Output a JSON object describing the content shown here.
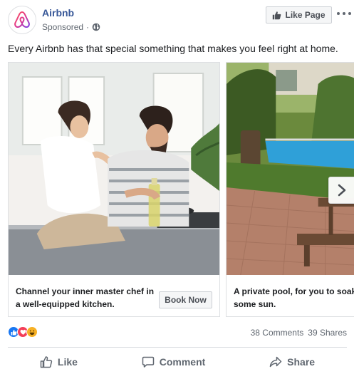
{
  "post": {
    "page_name": "Airbnb",
    "sponsored_label": "Sponsored",
    "separator": "·",
    "like_page_label": "Like Page",
    "text": "Every Airbnb has that special something that makes you feel right at home.",
    "brand_color": "#ff5a5f",
    "link_color": "#385898"
  },
  "cards": [
    {
      "caption": "Channel your inner master chef in a well-equipped kitchen.",
      "cta_label": "Book Now",
      "image": "couple-cooking-in-kitchen"
    },
    {
      "caption": "A private pool, for you to soak some sun.",
      "image": "garden-with-private-pool"
    }
  ],
  "stats": {
    "reaction_icons": [
      "like-icon",
      "love-icon",
      "haha-icon"
    ],
    "comments": "38 Comments",
    "shares": "39 Shares"
  },
  "actions": {
    "like": "Like",
    "comment": "Comment",
    "share": "Share"
  }
}
